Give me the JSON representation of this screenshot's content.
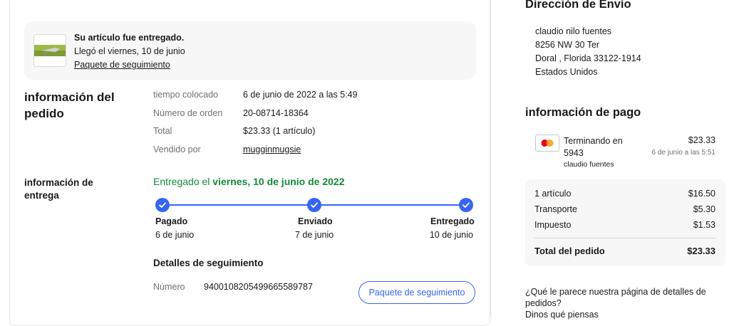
{
  "banner": {
    "status": "Su artículo fue entregado.",
    "arrival": "Llegó el viernes, 10 de junio",
    "tracking_link": "Paquete de seguimiento"
  },
  "order_info": {
    "heading_line1": "información del",
    "heading_line2": "pedido",
    "rows": [
      {
        "label": "tiempo colocado",
        "value": "6 de junio de 2022 a las 5:49"
      },
      {
        "label": "Número de orden",
        "value": "20-08714-18364"
      },
      {
        "label": "Total",
        "value": "$23.33 (1 artículo)"
      },
      {
        "label": "Vendido por",
        "value": "mugginmugsie"
      }
    ]
  },
  "delivery_info": {
    "heading_line1": "información de",
    "heading_line2": "entrega",
    "status_prefix": "Entregado el",
    "status_date": "viernes, 10 de junio de 2022",
    "steps": [
      {
        "label": "Pagado",
        "date": "6 de junio"
      },
      {
        "label": "Enviado",
        "date": "7 de junio"
      },
      {
        "label": "Entregado",
        "date": "10 de junio"
      }
    ],
    "tracking_heading": "Detalles de seguimiento",
    "tracking_number_label": "Número",
    "tracking_number": "9400108205499665589787",
    "tracking_button": "Paquete de seguimiento"
  },
  "shipping": {
    "heading": "Dirección de Envío",
    "lines": [
      "claudio nilo fuentes",
      "8256 NW 30 Ter",
      "Doral , Florida 33122-1914",
      "Estados Unidos"
    ]
  },
  "payment": {
    "heading": "información de pago",
    "card_line1": "Terminando en",
    "card_line2": "5943",
    "card_holder": "claudio fuentes",
    "amount": "$23.33",
    "date": "6 de junio a las 5:51",
    "summary": [
      {
        "label": "1 artículo",
        "value": "$16.50"
      },
      {
        "label": "Transporte",
        "value": "$5.30"
      },
      {
        "label": "Impuesto",
        "value": "$1.53"
      }
    ],
    "total_label": "Total del pedido",
    "total_value": "$23.33"
  },
  "feedback": {
    "question_line1": "¿Qué le parece nuestra página de detalles de",
    "question_line2": "pedidos?",
    "link": "Dinos qué piensas"
  },
  "colors": {
    "accent": "#3665f3",
    "delivered_green": "#118a38"
  }
}
